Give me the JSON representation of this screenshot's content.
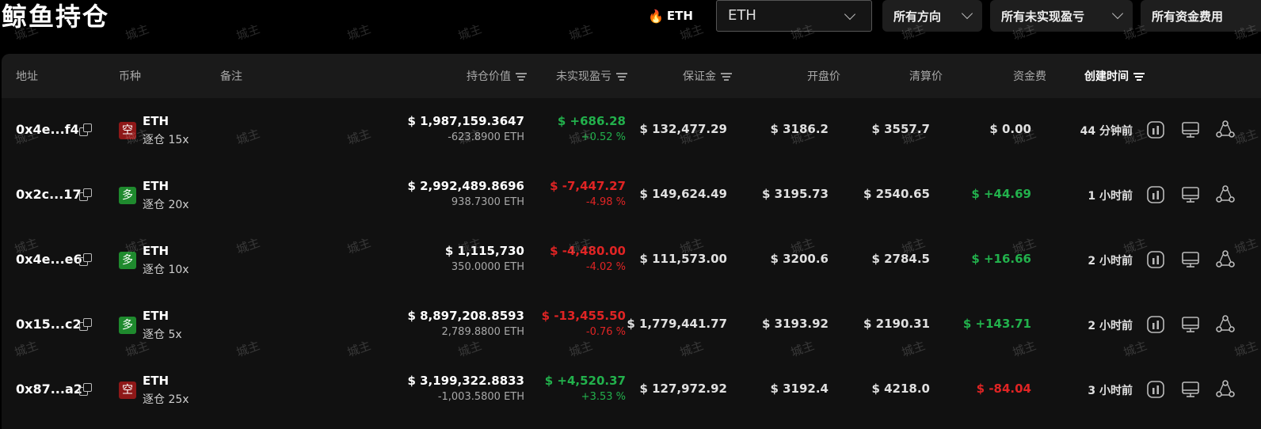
{
  "page_title": "鲸鱼持仓",
  "asset_chip": "ETH",
  "asset_select": "ETH",
  "filters": [
    "所有方向",
    "所有未实现盈亏",
    "所有资金费用"
  ],
  "columns": {
    "address": "地址",
    "coin": "币种",
    "note": "备注",
    "value": "持仓价值",
    "pnl": "未实现盈亏",
    "margin": "保证金",
    "entry": "开盘价",
    "liq": "清算价",
    "funding": "资金费",
    "created": "创建时间"
  },
  "colors": {
    "up": "#22b14c",
    "down": "#e02424",
    "long_badge": "#1f8a2e",
    "short_badge": "#8e1818"
  },
  "rows": [
    {
      "address": "0x4e...f4",
      "side": "空",
      "side_color": "#8e1818",
      "coin": "ETH",
      "leverage": "逐仓 15x",
      "value": "$ 1,987,159.3647",
      "amount": "-623.8900 ETH",
      "pnl": "$ +686.28",
      "pnl_pct": "+0.52 %",
      "pnl_color": "#22b14c",
      "margin": "$ 132,477.29",
      "entry": "$ 3186.2",
      "liq": "$ 3557.7",
      "funding": "$ 0.00",
      "funding_color": "#e0e0e0",
      "created": "44 分钟前"
    },
    {
      "address": "0x2c...17",
      "side": "多",
      "side_color": "#1f8a2e",
      "coin": "ETH",
      "leverage": "逐仓 20x",
      "value": "$ 2,992,489.8696",
      "amount": "938.7300 ETH",
      "pnl": "$ -7,447.27",
      "pnl_pct": "-4.98 %",
      "pnl_color": "#e02424",
      "margin": "$ 149,624.49",
      "entry": "$ 3195.73",
      "liq": "$ 2540.65",
      "funding": "$ +44.69",
      "funding_color": "#22b14c",
      "created": "1 小时前"
    },
    {
      "address": "0x4e...e6",
      "side": "多",
      "side_color": "#1f8a2e",
      "coin": "ETH",
      "leverage": "逐仓 10x",
      "value": "$ 1,115,730",
      "amount": "350.0000 ETH",
      "pnl": "$ -4,480.00",
      "pnl_pct": "-4.02 %",
      "pnl_color": "#e02424",
      "margin": "$ 111,573.00",
      "entry": "$ 3200.6",
      "liq": "$ 2784.5",
      "funding": "$ +16.66",
      "funding_color": "#22b14c",
      "created": "2 小时前"
    },
    {
      "address": "0x15...c2",
      "side": "多",
      "side_color": "#1f8a2e",
      "coin": "ETH",
      "leverage": "逐仓 5x",
      "value": "$ 8,897,208.8593",
      "amount": "2,789.8800 ETH",
      "pnl": "$ -13,455.50",
      "pnl_pct": "-0.76 %",
      "pnl_color": "#e02424",
      "margin": "$ 1,779,441.77",
      "entry": "$ 3193.92",
      "liq": "$ 2190.31",
      "funding": "$ +143.71",
      "funding_color": "#22b14c",
      "created": "2 小时前"
    },
    {
      "address": "0x87...a2",
      "side": "空",
      "side_color": "#8e1818",
      "coin": "ETH",
      "leverage": "逐仓 25x",
      "value": "$ 3,199,322.8833",
      "amount": "-1,003.5800 ETH",
      "pnl": "$ +4,520.37",
      "pnl_pct": "+3.53 %",
      "pnl_color": "#22b14c",
      "margin": "$ 127,972.92",
      "entry": "$ 3192.4",
      "liq": "$ 4218.0",
      "funding": "$ -84.04",
      "funding_color": "#e02424",
      "created": "3 小时前"
    }
  ],
  "watermark": "城主"
}
